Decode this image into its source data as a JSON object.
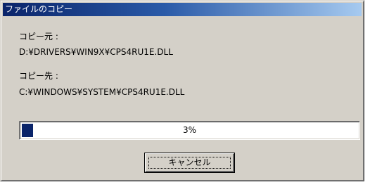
{
  "window": {
    "title": "ファイルのコピー"
  },
  "source": {
    "label": "コピー元 :",
    "path": "D:¥DRIVERS¥WIN9X¥CPS4RU1E.DLL"
  },
  "destination": {
    "label": "コピー先 :",
    "path": "C:¥WINDOWS¥SYSTEM¥CPS4RU1E.DLL"
  },
  "progress": {
    "percent": 3,
    "text": "3%",
    "fill_color": "#0a246a"
  },
  "buttons": {
    "cancel_label": "キャンセル"
  },
  "colors": {
    "titlebar_start": "#0a246a",
    "titlebar_end": "#a6caf0",
    "dialog_face": "#d4d0c8"
  }
}
